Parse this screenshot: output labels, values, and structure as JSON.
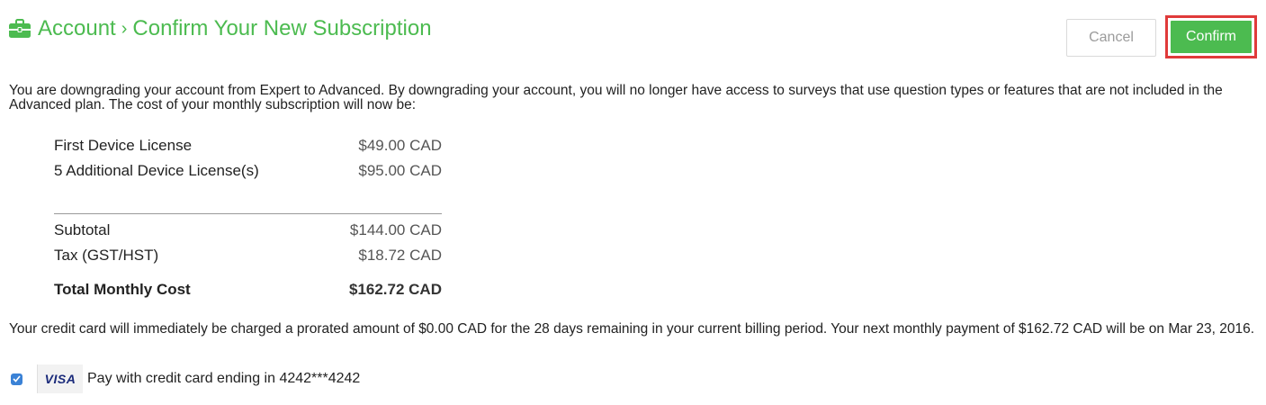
{
  "header": {
    "icon": "briefcase-icon",
    "breadcrumb_root": "Account",
    "separator": "›",
    "title": "Confirm Your New Subscription",
    "accent_color": "#4cbb50"
  },
  "actions": {
    "cancel_label": "Cancel",
    "confirm_label": "Confirm",
    "confirm_highlight_color": "#e03a3a"
  },
  "intro_text": "You are downgrading your account from Expert to Advanced. By downgrading your account, you will no longer have access to surveys that use question types or features that are not included in the Advanced plan. The cost of your monthly subscription will now be:",
  "line_items": [
    {
      "label": "First Device License",
      "amount": "$49.00 CAD"
    },
    {
      "label": "5 Additional Device License(s)",
      "amount": "$95.00 CAD"
    }
  ],
  "summary": [
    {
      "label": "Subtotal",
      "amount": "$144.00 CAD"
    },
    {
      "label": "Tax (GST/HST)",
      "amount": "$18.72 CAD"
    }
  ],
  "total": {
    "label": "Total Monthly Cost",
    "amount": "$162.72 CAD"
  },
  "charge_notice": "Your credit card will immediately be charged a prorated amount of $0.00 CAD for the 28 days remaining in your current billing period. Your next monthly payment of $162.72 CAD will be on Mar 23, 2016.",
  "payment": {
    "checked": true,
    "card_brand": "VISA",
    "label": "Pay with credit card ending in 4242***4242"
  }
}
